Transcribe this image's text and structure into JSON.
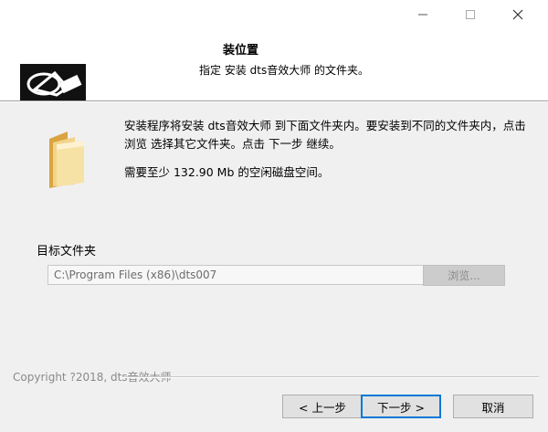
{
  "header": {
    "title": "装位置",
    "subtitle": "指定 安装 dts音效大师 的文件夹。"
  },
  "body": {
    "description": "安装程序将安装 dts音效大师 到下面文件夹内。要安装到不同的文件夹内，点击 浏览 选择其它文件夹。点击 下一步 继续。",
    "space_required": "需要至少 132.90 Mb 的空闲磁盘空间。"
  },
  "target": {
    "label": "目标文件夹",
    "path": "C:\\Program Files (x86)\\dts007",
    "browse_label": "浏览..."
  },
  "footer": {
    "copyright": "Copyright ?2018, dts音效大师"
  },
  "buttons": {
    "back": "< 上一步",
    "next": "下一步 >",
    "cancel": "取消"
  },
  "colors": {
    "accent": "#0078d7",
    "window_bg": "#f0f0f0",
    "header_bg": "#ffffff"
  }
}
